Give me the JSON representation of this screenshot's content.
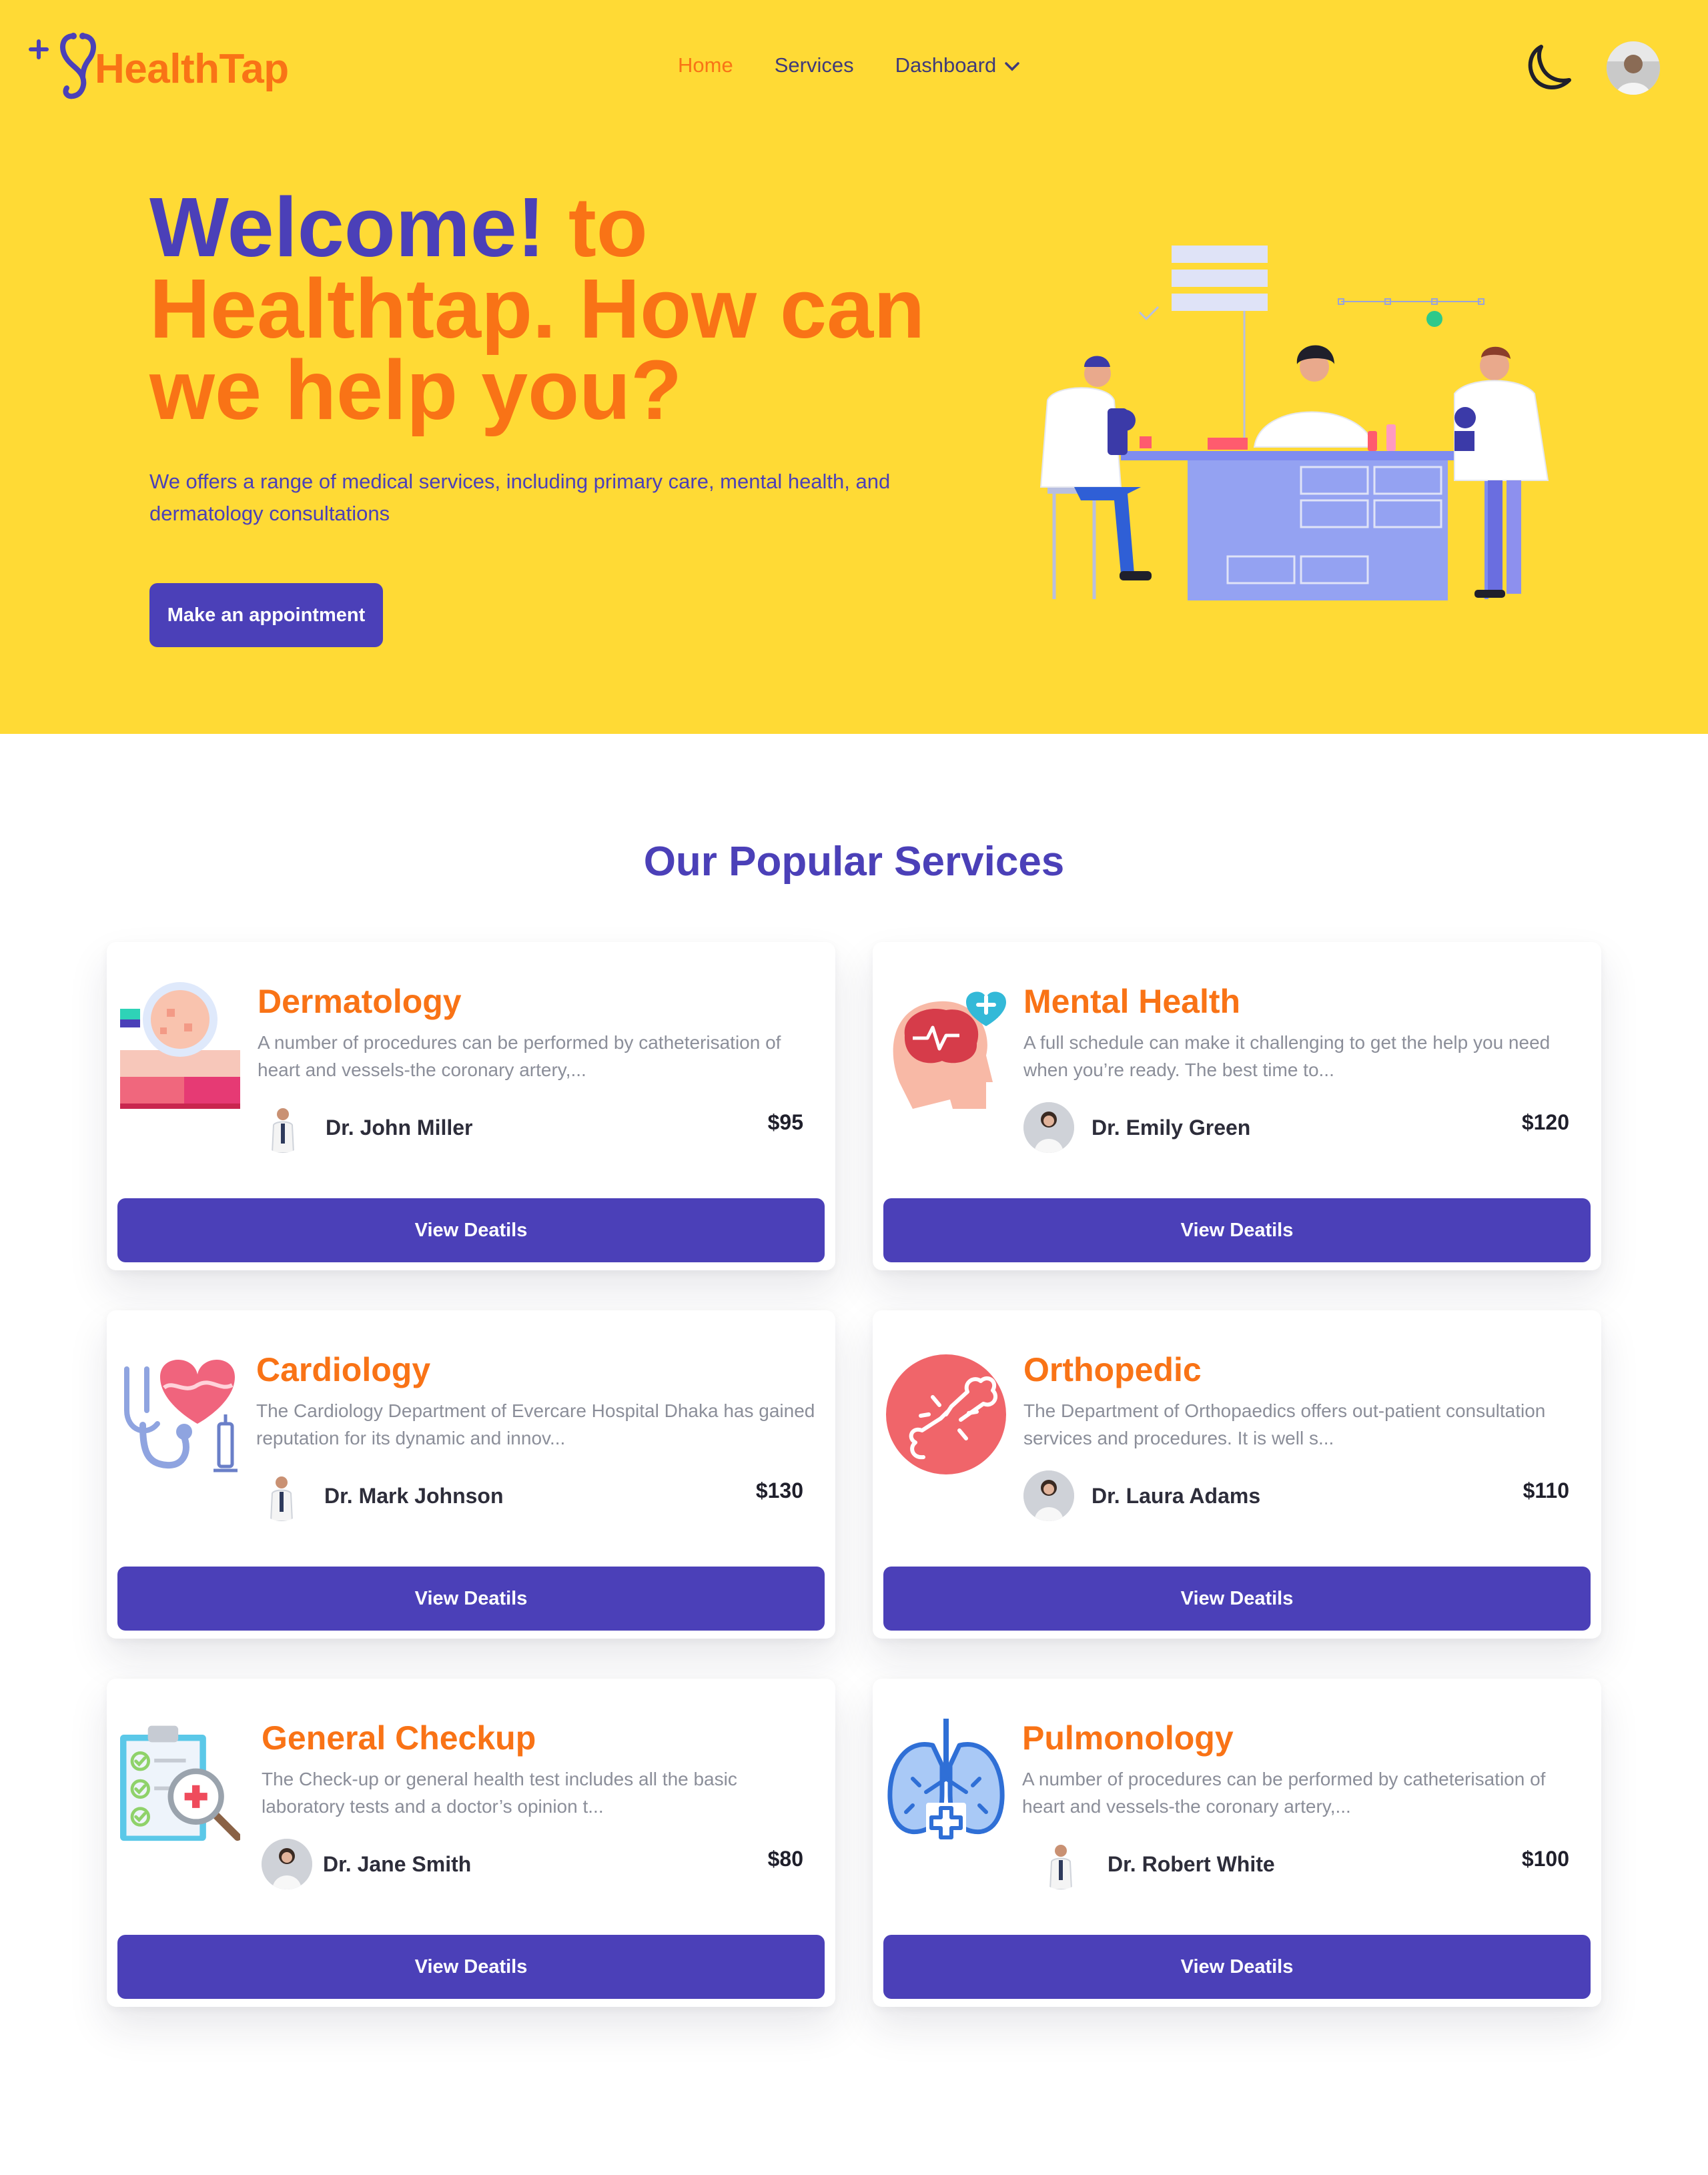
{
  "brand": {
    "name_part1": "Health",
    "name_part2": "Tap"
  },
  "nav": {
    "home": "Home",
    "services": "Services",
    "dashboard": "Dashboard"
  },
  "hero": {
    "title_highlight": "Welcome!",
    "title_rest": " to Healthtap. How can we help you?",
    "subtitle": "We offers a range of medical services, including primary care, mental health, and dermatology consultations",
    "cta": "Make an appointment"
  },
  "services": {
    "heading": "Our Popular Services",
    "button_label": "View Deatils",
    "items": [
      {
        "title": "Dermatology",
        "desc": "A number of procedures can be performed by catheterisation of heart and vessels-the coronary artery,...",
        "doctor": "Dr. John Miller",
        "price": "$95",
        "icon": "skin-icon"
      },
      {
        "title": "Mental Health",
        "desc": "A full schedule can make it challenging to get the help you need when you’re ready. The best time to...",
        "doctor": "Dr. Emily Green",
        "price": "$120",
        "icon": "brain-icon"
      },
      {
        "title": "Cardiology",
        "desc": "The Cardiology Department of Evercare Hospital Dhaka has gained reputation for its dynamic and innov...",
        "doctor": "Dr. Mark Johnson",
        "price": "$130",
        "icon": "heart-stethoscope-icon"
      },
      {
        "title": "Orthopedic",
        "desc": "The Department of Orthopaedics offers out-patient consultation services and procedures. It is well s...",
        "doctor": "Dr. Laura Adams",
        "price": "$110",
        "icon": "bone-icon"
      },
      {
        "title": "General Checkup",
        "desc": "The Check-up or general health test includes all the basic laboratory tests and a doctor’s opinion t...",
        "doctor": "Dr. Jane Smith",
        "price": "$80",
        "icon": "clipboard-icon"
      },
      {
        "title": "Pulmonology",
        "desc": "A number of procedures can be performed by catheterisation of heart and vessels-the coronary artery,...",
        "doctor": "Dr. Robert White",
        "price": "$100",
        "icon": "lungs-icon"
      }
    ]
  },
  "colors": {
    "hero_bg": "#FFDA35",
    "primary": "#4B40B8",
    "accent": "#F97316"
  }
}
